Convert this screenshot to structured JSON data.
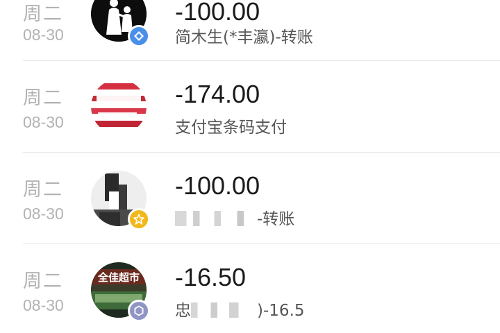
{
  "transactions": [
    {
      "day": "周二",
      "date": "08-30",
      "amount": "-100.00",
      "description": "简木生(*丰瀛)-转账",
      "badge_icon": "blue-diamond-badge-icon",
      "badge_color": "#4a8fe8"
    },
    {
      "day": "周二",
      "date": "08-30",
      "amount": "-174.00",
      "description": "支付宝条码支付",
      "badge_icon": "",
      "badge_color": ""
    },
    {
      "day": "周二",
      "date": "08-30",
      "amount": "-100.00",
      "description": "-转账",
      "badge_icon": "gold-star-badge-icon",
      "badge_color": "#f2b81a"
    },
    {
      "day": "周二",
      "date": "08-30",
      "amount": "-16.50",
      "description": "忠",
      "description_tail": ")-16.5",
      "badge_icon": "grey-hexagon-badge-icon",
      "badge_color": "#8f96c4"
    }
  ],
  "avatars": {
    "row3_sign_text": "全佳超市"
  }
}
